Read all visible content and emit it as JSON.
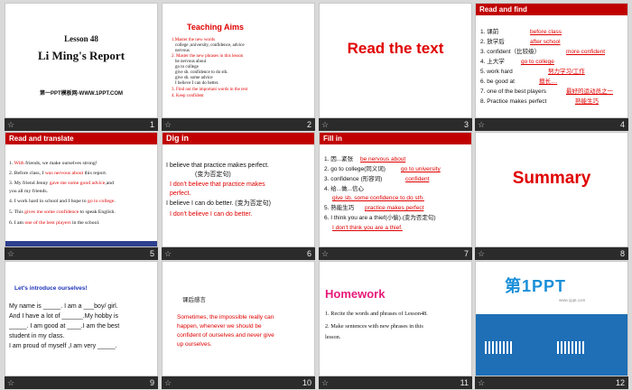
{
  "s1": {
    "n": "1",
    "title1": "Lesson 48",
    "title2": "Li Ming's Report",
    "sub": "第一PPT模板网-WWW.1PPT.COM"
  },
  "s2": {
    "n": "2",
    "title": "Teaching  Aims",
    "lines": [
      "1.Master  the new words",
      "college ,university, confidence, advice",
      "nervous",
      "2. Master the new phrases in this lesson",
      "be nervous about",
      "go to college",
      "give sb. confidence to do sth.",
      "give sb. some advice",
      "I believe I can do better.",
      "3. Find out the important words in the text",
      "4. Keep confident"
    ]
  },
  "s3": {
    "n": "3",
    "title": "Read the text"
  },
  "s4": {
    "n": "4",
    "header": "Read and find",
    "items": [
      {
        "k": "1. 课前",
        "v": "before class"
      },
      {
        "k": "2. 放学后",
        "v": "after school"
      },
      {
        "k": "3. confident（比较级）",
        "v": "more confident"
      },
      {
        "k": "4. 上大学",
        "v": "go to college"
      },
      {
        "k": "5. work hard",
        "v": "努力学习/工作"
      },
      {
        "k": "6. be good at",
        "v": "擅长...."
      },
      {
        "k": "7. one of the best players",
        "v": "最好的运动员之一"
      },
      {
        "k": "8. Practice makes perfect",
        "v": "熟能生巧"
      }
    ]
  },
  "s5": {
    "n": "5",
    "header": "Read and translate",
    "lines": [
      {
        "a": "1. ",
        "r": "With",
        "b": " friends, we make ourselves strong!"
      },
      {
        "a": "2. Before class, I ",
        "r": "was nervous  about",
        "b": "  this report."
      },
      {
        "a": "3. My  friend Jenny ",
        "r": "gave me some good advice",
        "b": ",and"
      },
      {
        "a": "    you all my friends.",
        "r": "",
        "b": ""
      },
      {
        "a": "4. I work hard  in school and  I hope  to ",
        "r": "go to college",
        "b": "."
      },
      {
        "a": "5. This ",
        "r": "gives me some confidence",
        "b": " to speak English."
      },
      {
        "a": "6. I am ",
        "r": "one of the best players",
        "b": " in the school."
      }
    ]
  },
  "s6": {
    "n": "6",
    "header": "Dig in",
    "l1": "I believe that practice makes  perfect.",
    "l2": "(变为否定句)",
    "l3": "I don't believe that practice makes",
    "l4": "perfect.",
    "l5": "I believe I can do better. (变为否定句)",
    "l6": "I don't believe I can do better."
  },
  "s7": {
    "n": "7",
    "header": "Fill in",
    "items": [
      {
        "k": "1. 因...紧张",
        "v": "be nervous about"
      },
      {
        "k": "2. go to college(同义词)",
        "v": "go to university"
      },
      {
        "k": "3. confidence (形容词)",
        "v": "confident"
      },
      {
        "k": "4. 给...做...信心",
        "v": ""
      },
      {
        "k": "",
        "v": "give sb. some confidence to do sth."
      },
      {
        "k": "5. 熟能生巧",
        "v": "practice makes perfect"
      },
      {
        "k": "6. I think you are a thief(小偷).(变为否定句)",
        "v": ""
      },
      {
        "k": "",
        "v": "I don't think you are a thief."
      }
    ]
  },
  "s8": {
    "n": "8",
    "title": "Summary"
  },
  "s9": {
    "n": "9",
    "title": "Let's introduce ourselves!",
    "lines": [
      "My name is _____.  I am a ___boy/ girl.",
      "And  I have a lot of ______.My hobby is",
      "_____. I am good at ____.I am the best",
      "student in my  class.",
      "I am proud of myself  ,I am very _____."
    ]
  },
  "s10": {
    "n": "10",
    "title": "课后感言",
    "lines": [
      "Sometimes, the impossible  really can",
      "happen, whenever we should be",
      "confident of ourselves  and never give",
      "up ourselves."
    ]
  },
  "s11": {
    "n": "11",
    "title": "Homework",
    "lines": [
      "1. Recite the words and phrases of Lesson48.",
      "2. Make sentences with new phrases in this",
      "    lesson."
    ]
  },
  "s12": {
    "n": "12",
    "logo": "第1PPT",
    "sub": "www.1ppt.com"
  },
  "colors": {
    "accent": "#e00000",
    "headerbar": "#c00000",
    "footer": "#2b2b2b"
  }
}
